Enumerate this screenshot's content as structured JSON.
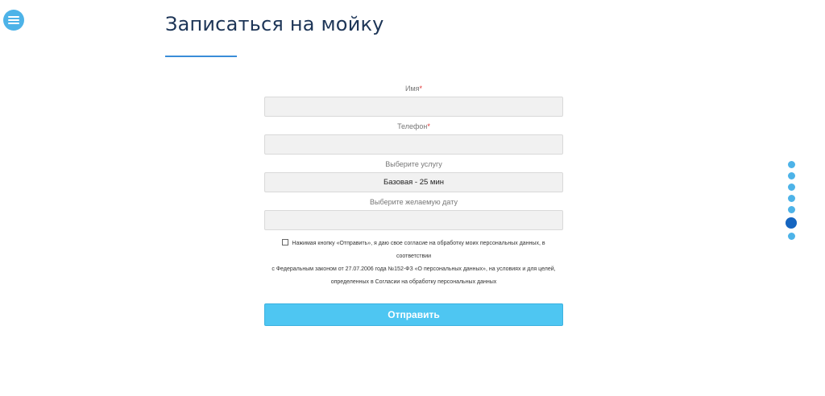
{
  "header": {
    "menu_icon": "hamburger-menu-icon",
    "title": "Записаться на мойку"
  },
  "form": {
    "name_label": "Имя",
    "name_required": "*",
    "name_value": "",
    "phone_label": "Телефон",
    "phone_required": "*",
    "phone_value": "",
    "service_label": "Выберите услугу",
    "service_selected": "Базовая - 25 мин",
    "date_label": "Выберите желаемую дату",
    "date_value": "",
    "consent_line1": "Нажимая кнопку «Отправить», я даю свое согласие на обработку моих персональных данных, в соответствии",
    "consent_line2": "с Федеральным законом от 27.07.2006 года №152-ФЗ «О персональных данных», на условиях и для целей,",
    "consent_line3": "определенных в Согласии на обработку персональных данных",
    "consent_checked": false,
    "submit_label": "Отправить"
  },
  "section_nav": {
    "count": 7,
    "active_index": 5,
    "dot_color": "#4db3e8",
    "active_color": "#1565c0"
  },
  "colors": {
    "accent": "#4ec6f2",
    "title": "#1d3557",
    "underline": "#3a8dd8",
    "required": "#e03131"
  }
}
